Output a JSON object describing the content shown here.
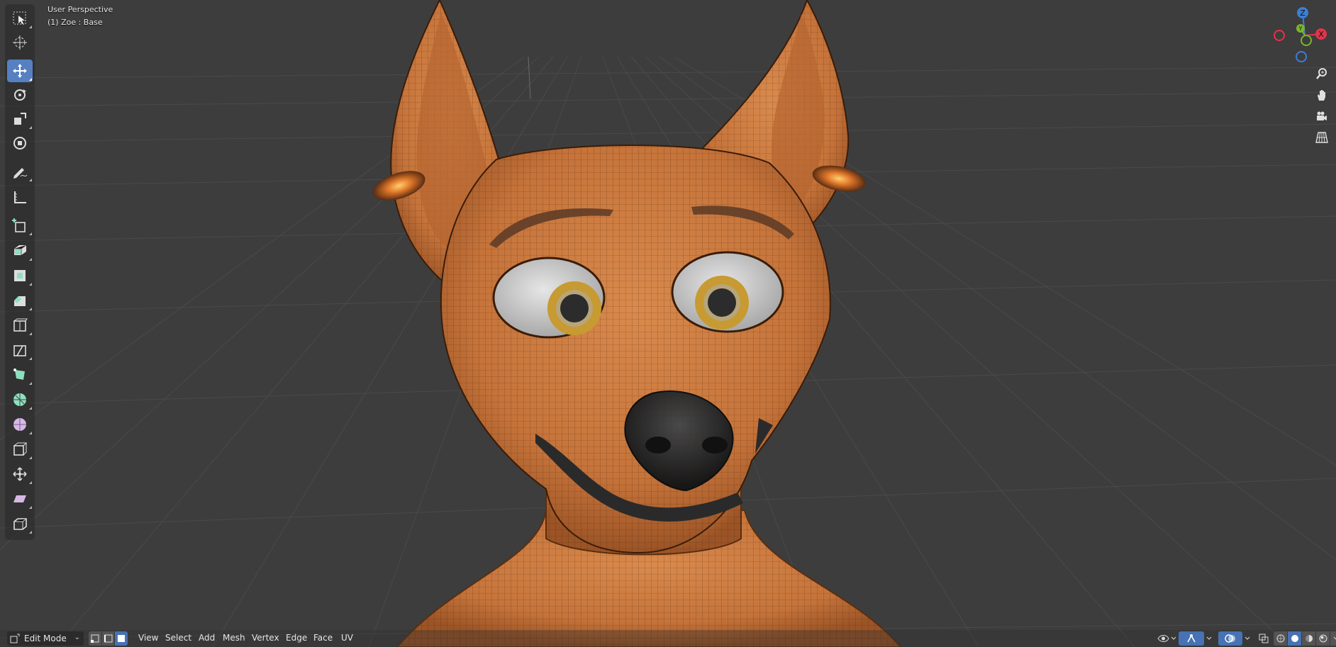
{
  "viewport": {
    "perspective_label": "User Perspective",
    "object_label": "(1) Zoe  : Base"
  },
  "toolbar": {
    "tools": [
      {
        "name": "select-box-icon",
        "active": false
      },
      {
        "name": "cursor-icon",
        "active": false
      },
      {
        "name": "move-icon",
        "active": true
      },
      {
        "name": "rotate-icon",
        "active": false
      },
      {
        "name": "scale-icon",
        "active": false
      },
      {
        "name": "transform-icon",
        "active": false
      },
      {
        "name": "annotate-icon",
        "active": false
      },
      {
        "name": "measure-icon",
        "active": false
      },
      {
        "name": "add-cube-icon",
        "active": false
      },
      {
        "name": "extrude-region-icon",
        "active": false
      },
      {
        "name": "inset-faces-icon",
        "active": false
      },
      {
        "name": "bevel-icon",
        "active": false
      },
      {
        "name": "loop-cut-icon",
        "active": false
      },
      {
        "name": "knife-icon",
        "active": false
      },
      {
        "name": "poly-build-icon",
        "active": false
      },
      {
        "name": "spin-icon",
        "active": false
      },
      {
        "name": "smooth-icon",
        "active": false
      },
      {
        "name": "edge-slide-icon",
        "active": false
      },
      {
        "name": "shrink-fatten-icon",
        "active": false
      },
      {
        "name": "shear-icon",
        "active": false
      },
      {
        "name": "rip-region-icon",
        "active": false
      }
    ]
  },
  "gizmo": {
    "axes": [
      "Z",
      "Y",
      "X"
    ],
    "x_color": "#e2334a",
    "y_color": "#7db52a",
    "z_color": "#3a7fd6"
  },
  "header": {
    "mode": "Edit Mode",
    "menus": [
      "View",
      "Select",
      "Add",
      "Mesh",
      "Vertex",
      "Edge",
      "Face",
      "UV"
    ],
    "select_mode_active": "face"
  },
  "colors": {
    "mesh": "#c8773e",
    "active_tool": "#5680c2",
    "background": "#3d3d3d"
  }
}
